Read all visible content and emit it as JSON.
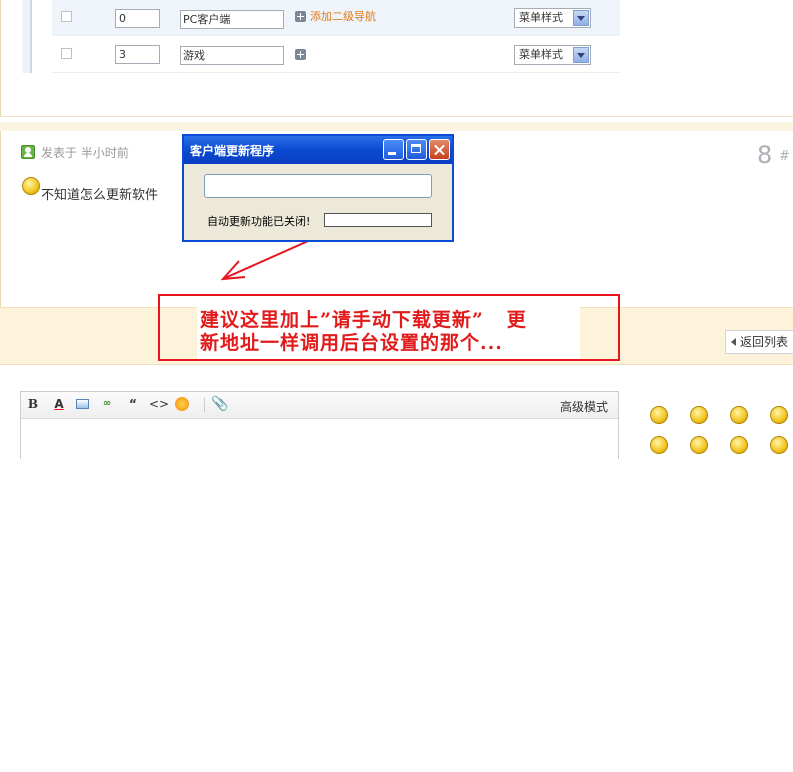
{
  "nav_table": {
    "rows": [
      {
        "order": "0",
        "name": "PC客户端",
        "add_label": "添加二级导航",
        "style": "菜单样式"
      },
      {
        "order": "3",
        "name": "游戏",
        "add_label": "",
        "style": "菜单样式"
      }
    ]
  },
  "post": {
    "posted_at": "发表于 半小时前",
    "floor": "8",
    "floor_suffix": "#",
    "text": "不知道怎么更新软件"
  },
  "dialog": {
    "title": "客户端更新程序",
    "status": "自动更新功能已关闭!"
  },
  "annotation": {
    "line1": "建议这里加上”请手动下载更新”   更",
    "line2": "新地址一样调用后台设置的那个..."
  },
  "actions": {
    "back_label": "返回列表"
  },
  "editor": {
    "bold_label": "B",
    "color_label": "A",
    "link_label": "∞",
    "quote_label": "“",
    "code_label": "<>",
    "attach_label": "📎",
    "advanced_mode": "高级模式"
  },
  "icons": [
    "user-icon",
    "sad-face-icon",
    "minimize-icon",
    "maximize-icon",
    "close-icon",
    "plus-icon",
    "dropdown-arrow-icon",
    "back-arrow-icon",
    "smiley-icon"
  ],
  "colors": {
    "annotation": "#e8141e",
    "titlebar": "#0a4ad0",
    "accent_orange": "#e07a17"
  }
}
